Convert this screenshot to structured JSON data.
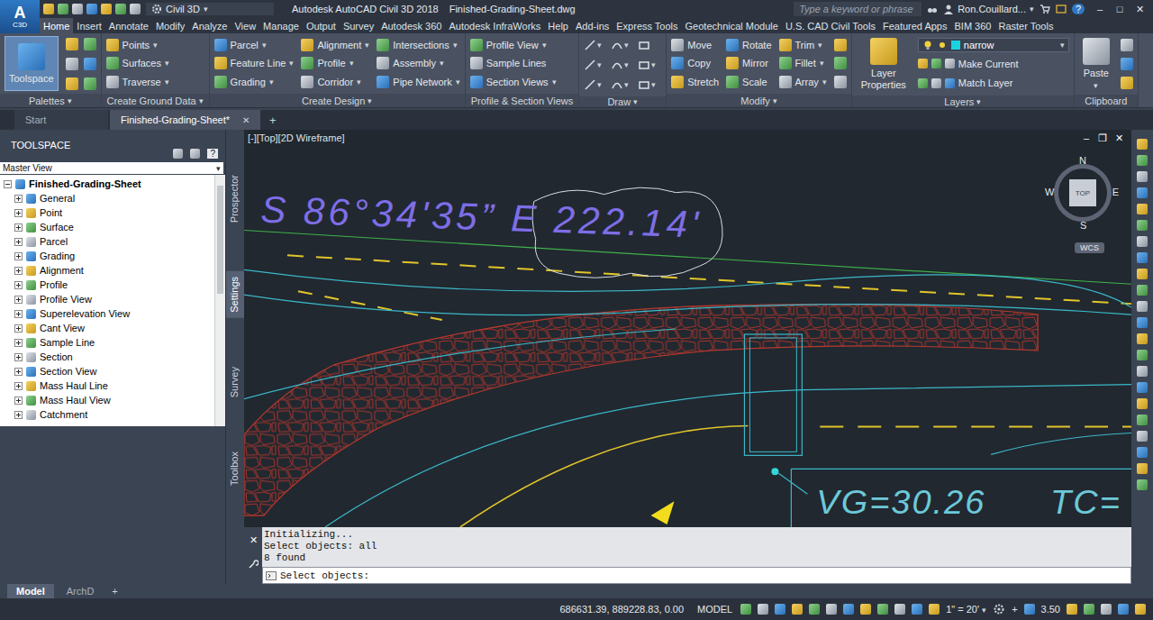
{
  "app": {
    "logo": "A",
    "logo_sub": "C3D"
  },
  "title_bar": {
    "workspace": "Civil 3D",
    "title": "Autodesk AutoCAD Civil 3D 2018",
    "file": "Finished-Grading-Sheet.dwg",
    "search_placeholder": "Type a keyword or phrase",
    "user": "Ron.Couillard...",
    "help": "?",
    "window_buttons": [
      "–",
      "□",
      "✕"
    ]
  },
  "caret": "▾",
  "ribbon_tabs": [
    {
      "label": "Home",
      "selected": true
    },
    {
      "label": "Insert",
      "selected": false
    },
    {
      "label": "Annotate",
      "selected": false
    },
    {
      "label": "Modify",
      "selected": false
    },
    {
      "label": "Analyze",
      "selected": false
    },
    {
      "label": "View",
      "selected": false
    },
    {
      "label": "Manage",
      "selected": false
    },
    {
      "label": "Output",
      "selected": false
    },
    {
      "label": "Survey",
      "selected": false
    },
    {
      "label": "Autodesk 360",
      "selected": false
    },
    {
      "label": "Autodesk InfraWorks",
      "selected": false
    },
    {
      "label": "Help",
      "selected": false
    },
    {
      "label": "Add-ins",
      "selected": false
    },
    {
      "label": "Express Tools",
      "selected": false
    },
    {
      "label": "Geotechnical Module",
      "selected": false
    },
    {
      "label": "U.S. CAD Civil Tools",
      "selected": false
    },
    {
      "label": "Featured Apps",
      "selected": false
    },
    {
      "label": "BIM 360",
      "selected": false
    },
    {
      "label": "Raster Tools",
      "selected": false
    }
  ],
  "palettes": {
    "label": "Palettes",
    "dropdown": true,
    "big": {
      "label": "Toolspace",
      "selected": true
    }
  },
  "ground": {
    "label": "Create Ground Data",
    "dropdown": true,
    "items": [
      {
        "label": "Points",
        "dropdown": true
      },
      {
        "label": "Surfaces",
        "dropdown": true
      },
      {
        "label": "Traverse",
        "dropdown": true
      }
    ]
  },
  "design": {
    "label": "Create Design",
    "dropdown": true,
    "columns": [
      [
        {
          "label": "Parcel",
          "dropdown": true
        },
        {
          "label": "Feature Line",
          "dropdown": true
        },
        {
          "label": "Grading",
          "dropdown": true
        }
      ],
      [
        {
          "label": "Alignment",
          "dropdown": true
        },
        {
          "label": "Profile",
          "dropdown": true
        },
        {
          "label": "Corridor",
          "dropdown": true
        }
      ],
      [
        {
          "label": "Intersections",
          "dropdown": true
        },
        {
          "label": "Assembly",
          "dropdown": true
        },
        {
          "label": "Pipe Network",
          "dropdown": true
        }
      ]
    ]
  },
  "views": {
    "label": "Profile & Section Views",
    "dropdown": false,
    "items": [
      {
        "label": "Profile View",
        "dropdown": true
      },
      {
        "label": "Sample Lines",
        "dropdown": false
      },
      {
        "label": "Section Views",
        "dropdown": true
      }
    ]
  },
  "draw": {
    "label": "Draw",
    "dropdown": true,
    "tools": [
      {
        "dropdown": true
      },
      {
        "dropdown": true
      },
      {
        "dropdown": false
      },
      {
        "dropdown": true
      },
      {
        "dropdown": true
      },
      {
        "dropdown": true
      },
      {
        "dropdown": true
      },
      {
        "dropdown": true
      },
      {
        "dropdown": true
      }
    ]
  },
  "modify": {
    "label": "Modify",
    "dropdown": true,
    "columns": [
      [
        {
          "label": "Move",
          "dropdown": false
        },
        {
          "label": "Copy",
          "dropdown": false
        },
        {
          "label": "Stretch",
          "dropdown": false
        }
      ],
      [
        {
          "label": "Rotate",
          "dropdown": false
        },
        {
          "label": "Mirror",
          "dropdown": false
        },
        {
          "label": "Scale",
          "dropdown": false
        }
      ],
      [
        {
          "label": "Trim",
          "dropdown": true
        },
        {
          "label": "Fillet",
          "dropdown": true
        },
        {
          "label": "Array",
          "dropdown": true
        }
      ]
    ]
  },
  "layers": {
    "label": "Layers",
    "dropdown": true,
    "big": "Layer Properties",
    "current_layer": {
      "name": "narrow",
      "color": "#19d3e0"
    },
    "items": [
      "Make Current",
      "Match Layer"
    ]
  },
  "clipboard": {
    "label": "Clipboard",
    "dropdown": false,
    "big": "Paste"
  },
  "doc_tabs": [
    {
      "label": "Start",
      "selected": false,
      "closable": false
    },
    {
      "label": "Finished-Grading-Sheet*",
      "selected": true,
      "closable": true
    }
  ],
  "doc_close": "✕",
  "doc_add": "+",
  "toolspace": {
    "title": "TOOLSPACE",
    "help": "?",
    "view": "Master View",
    "root": {
      "label": "Finished-Grading-Sheet",
      "expanded": true
    },
    "items": [
      {
        "label": "General",
        "expanded": false
      },
      {
        "label": "Point",
        "expanded": false
      },
      {
        "label": "Surface",
        "expanded": false
      },
      {
        "label": "Parcel",
        "expanded": false
      },
      {
        "label": "Grading",
        "expanded": false
      },
      {
        "label": "Alignment",
        "expanded": false
      },
      {
        "label": "Profile",
        "expanded": false
      },
      {
        "label": "Profile View",
        "expanded": false
      },
      {
        "label": "Superelevation View",
        "expanded": false
      },
      {
        "label": "Cant View",
        "expanded": false
      },
      {
        "label": "Sample Line",
        "expanded": false
      },
      {
        "label": "Section",
        "expanded": false
      },
      {
        "label": "Section View",
        "expanded": false
      },
      {
        "label": "Mass Haul Line",
        "expanded": false
      },
      {
        "label": "Mass Haul View",
        "expanded": false
      },
      {
        "label": "Catchment",
        "expanded": false
      }
    ]
  },
  "side_tabs": [
    {
      "label": "Prospector",
      "selected": false
    },
    {
      "label": "Settings",
      "selected": true
    },
    {
      "label": "Survey",
      "selected": false
    },
    {
      "label": "Toolbox",
      "selected": false
    }
  ],
  "viewport": {
    "header": "[-][Top][2D Wireframe]",
    "controls": [
      "–",
      "❐",
      "✕"
    ],
    "viewcube": {
      "north": "N",
      "south": "S",
      "east": "E",
      "west": "W",
      "face": "TOP",
      "ucs": "WCS"
    },
    "annotations": {
      "bearing": "S 86°34'35” E 222.14'",
      "label_vg": "VG=30.26",
      "label_tc": "TC="
    }
  },
  "command": {
    "close": "✕",
    "history": [
      "Initializing...",
      "Select objects: all",
      "8 found"
    ],
    "prompt": "Select objects:"
  },
  "layout_tabs": [
    {
      "label": "Model",
      "selected": true
    },
    {
      "label": "ArchD",
      "selected": false
    }
  ],
  "layout_add": "+",
  "status": {
    "coordinates": "686631.39, 889228.83, 0.00",
    "space": "MODEL",
    "scale": "1\" = 20'",
    "plus": "+",
    "value": "3.50"
  }
}
